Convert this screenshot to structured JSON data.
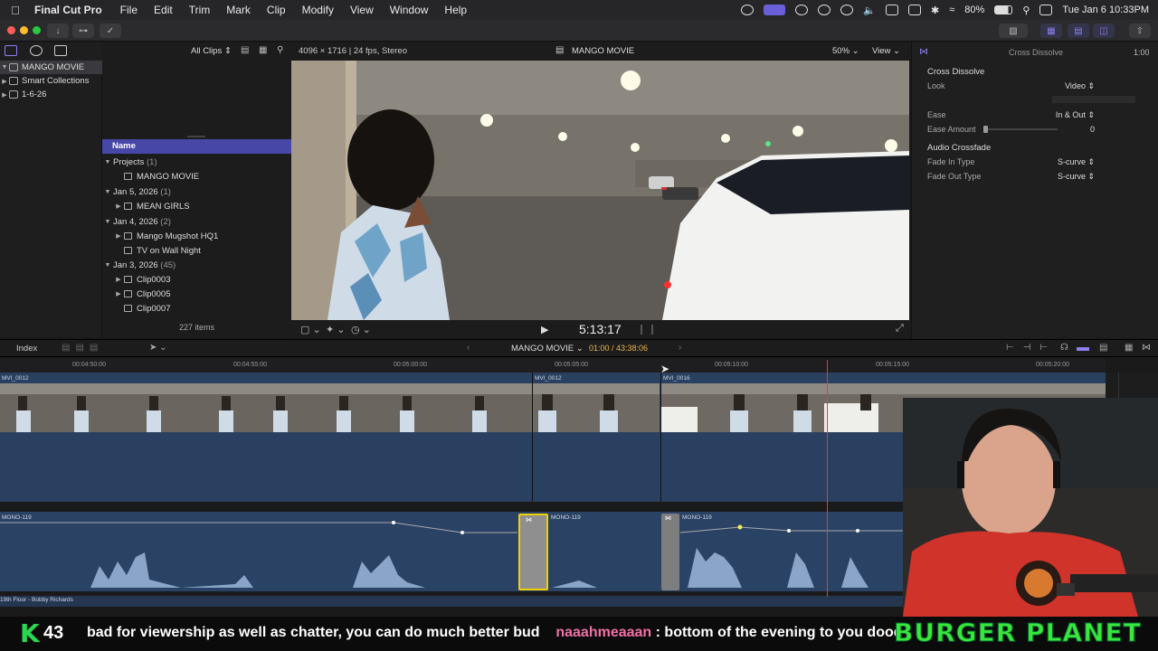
{
  "menubar": {
    "app_name": "Final Cut Pro",
    "items": [
      "File",
      "Edit",
      "Trim",
      "Mark",
      "Clip",
      "Modify",
      "View",
      "Window",
      "Help"
    ],
    "battery": "80%",
    "datetime": "Tue Jan 6  10:33PM"
  },
  "library": {
    "items": [
      {
        "label": "MANGO MOVIE",
        "selected": true
      },
      {
        "label": "Smart Collections",
        "selected": false
      },
      {
        "label": "1-6-26",
        "selected": false
      }
    ]
  },
  "browser": {
    "filter": "All Clips",
    "column_header": "Name",
    "rows": [
      {
        "label": "Projects",
        "count": "(1)",
        "level": 0,
        "expanded": true
      },
      {
        "label": "MANGO MOVIE",
        "count": "",
        "level": 1,
        "expanded": false
      },
      {
        "label": "Jan 5, 2026",
        "count": "(1)",
        "level": 0,
        "expanded": true
      },
      {
        "label": "MEAN GIRLS",
        "count": "",
        "level": 1,
        "expanded": false
      },
      {
        "label": "Jan 4, 2026",
        "count": "(2)",
        "level": 0,
        "expanded": true
      },
      {
        "label": "Mango Mugshot HQ1",
        "count": "",
        "level": 1,
        "expanded": false
      },
      {
        "label": "TV on Wall Night",
        "count": "",
        "level": 1,
        "expanded": false
      },
      {
        "label": "Jan 3, 2026",
        "count": "(45)",
        "level": 0,
        "expanded": true
      },
      {
        "label": "Clip0003",
        "count": "",
        "level": 1,
        "expanded": false
      },
      {
        "label": "Clip0005",
        "count": "",
        "level": 1,
        "expanded": false
      },
      {
        "label": "Clip0007",
        "count": "",
        "level": 1,
        "expanded": false
      }
    ],
    "item_count": "227 items"
  },
  "viewer": {
    "format": "4096 × 1716 | 24 fps, Stereo",
    "title": "MANGO MOVIE",
    "zoom": "50%",
    "view_menu": "View",
    "timecode": "5:13:17"
  },
  "inspector": {
    "title": "Cross Dissolve",
    "duration": "1:00",
    "section1": "Cross Dissolve",
    "rows": [
      {
        "label": "Look",
        "value": "Video"
      },
      {
        "label": "Ease",
        "value": "In & Out"
      },
      {
        "label": "Ease Amount",
        "value": "0"
      }
    ],
    "section2": "Audio Crossfade",
    "rows2": [
      {
        "label": "Fade In Type",
        "value": "S-curve"
      },
      {
        "label": "Fade Out Type",
        "value": "S-curve"
      }
    ]
  },
  "timeline": {
    "index_label": "Index",
    "project": "MANGO MOVIE",
    "duration": "01:00 / 43:38:06",
    "ruler": [
      "00:04:50:00",
      "00:04:55:00",
      "00:05:00:00",
      "00:05:05:00",
      "00:05:10:00",
      "00:05:15:00",
      "00:05:20:00"
    ],
    "video_clips": [
      "MVI_0012",
      "MVI_0012",
      "MVI_0016"
    ],
    "audio_clips": [
      "MONO-119",
      "MONO-119",
      "MONO-119"
    ],
    "music_clip": "19th Floor - Bobby Richards"
  },
  "ticker": {
    "k": "K",
    "num": "43",
    "text1": "bad for viewership as well as chatter, you can do much better bud",
    "user": "naaahmeaaan",
    "text2": ": bottom of the evening to you dood",
    "brand": "BURGER PLANET"
  },
  "colors": {
    "accent": "#4747a8",
    "playhead": "#e04030",
    "brand_green": "#3ae63a"
  }
}
